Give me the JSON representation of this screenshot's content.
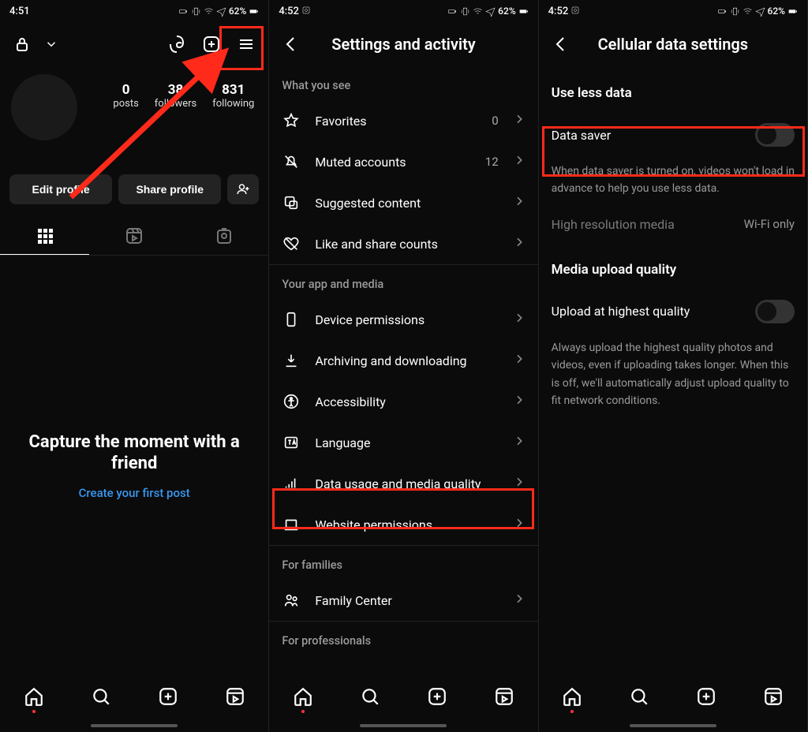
{
  "status": {
    "time1": "4:51",
    "time2": "4:52",
    "time3": "4:52",
    "battery": "62%"
  },
  "profile": {
    "stats": [
      {
        "num": "0",
        "lbl": "posts"
      },
      {
        "num": "38",
        "lbl": "followers"
      },
      {
        "num": "831",
        "lbl": "following"
      }
    ],
    "edit": "Edit profile",
    "share": "Share profile",
    "empty_h": "Capture the moment with a friend",
    "empty_link": "Create your first post"
  },
  "settings": {
    "title": "Settings and activity",
    "sections": [
      {
        "hdr": "What you see",
        "rows": [
          {
            "icon": "star",
            "label": "Favorites",
            "count": "0"
          },
          {
            "icon": "bell-off",
            "label": "Muted accounts",
            "count": "12"
          },
          {
            "icon": "sparkle",
            "label": "Suggested content"
          },
          {
            "icon": "heart-off",
            "label": "Like and share counts"
          }
        ]
      },
      {
        "hdr": "Your app and media",
        "rows": [
          {
            "icon": "phone",
            "label": "Device permissions"
          },
          {
            "icon": "download",
            "label": "Archiving and downloading"
          },
          {
            "icon": "accessibility",
            "label": "Accessibility"
          },
          {
            "icon": "language",
            "label": "Language"
          },
          {
            "icon": "signal",
            "label": "Data usage and media quality"
          },
          {
            "icon": "laptop",
            "label": "Website permissions"
          }
        ]
      },
      {
        "hdr": "For families",
        "rows": [
          {
            "icon": "family",
            "label": "Family Center"
          }
        ]
      },
      {
        "hdr": "For professionals",
        "rows": []
      }
    ]
  },
  "cellular": {
    "title": "Cellular data settings",
    "sec1": "Use less data",
    "data_saver": "Data saver",
    "data_saver_desc": "When data saver is turned on, videos won't load in advance to help you use less data.",
    "hires": "High resolution media",
    "hires_val": "Wi-Fi only",
    "sec2": "Media upload quality",
    "upload_hq": "Upload at highest quality",
    "upload_desc": "Always upload the highest quality photos and videos, even if uploading takes longer. When this is off, we'll automatically adjust upload quality to fit network conditions."
  }
}
